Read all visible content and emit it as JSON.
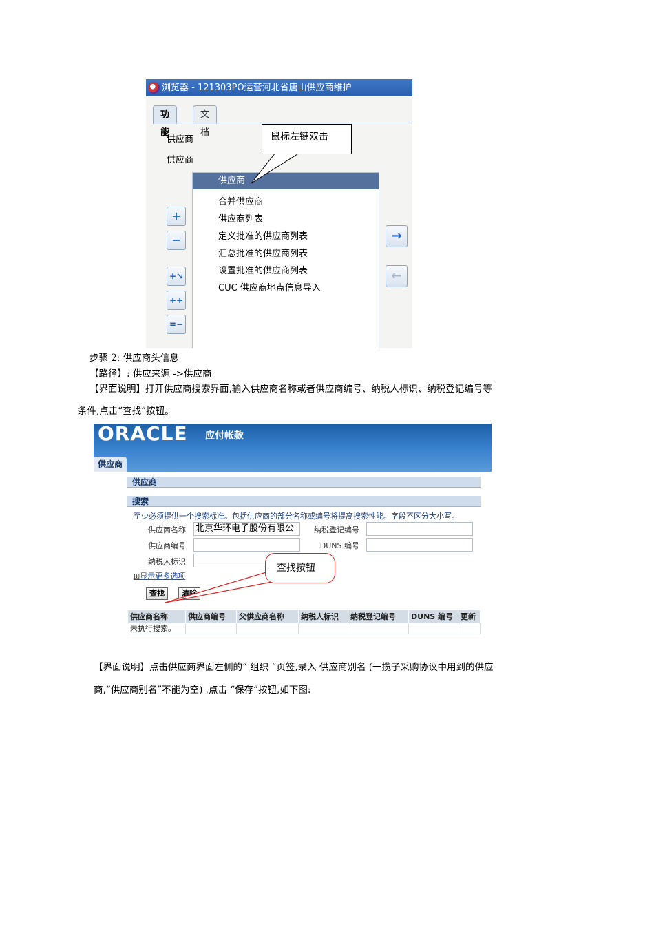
{
  "navigator": {
    "window_title": "浏览器 - 121303PO运营河北省唐山供应商维护",
    "tabs": [
      "功能",
      "文档"
    ],
    "tree_items": [
      "供应商",
      "供应商"
    ],
    "list_items": [
      "供应商",
      "合并供应商",
      "供应商列表",
      "定义批准的供应商列表",
      "汇总批准的供应商列表",
      "设置批准的供应商列表",
      "CUC 供应商地点信息导入"
    ],
    "callout": "鼠标左键双击",
    "left_buttons": [
      "+",
      "−",
      "+↘",
      "++",
      "=−"
    ],
    "right_buttons": [
      "→",
      "←"
    ]
  },
  "text": {
    "step": "步骤 2: 供应商头信息",
    "path": "【路径】: 供应来源 ->供应商",
    "desc1_line1": "【界面说明】打开供应商搜索界面,输入供应商名称或者供应商编号、纳税人标识、纳税登记编号等",
    "desc1_line2": "条件,点击“查找”按钮。",
    "desc2_line1": "【界面说明】点击供应商界面左侧的“ 组织 ”页签,录入 供应商别名 (一揽子采购协议中用到的供应",
    "desc2_line2": "商,“供应商别名”不能为空) ,点击 “保存”按钮,如下图:"
  },
  "oracle": {
    "logo": "ORACLE",
    "app_title": "应付帐款",
    "tab": "供应商",
    "page_header": "供应商",
    "search_header": "搜索",
    "hint": "至少必须提供一个搜索标准。包括供应商的部分名称或编号将提高搜索性能。字段不区分大小写。",
    "fields": {
      "supplier_name_label": "供应商名称",
      "supplier_name_value": "北京华环电子股份有限公",
      "tax_reg_label": "纳税登记编号",
      "supplier_num_label": "供应商编号",
      "duns_label": "DUNS 编号",
      "taxpayer_label": "纳税人标识"
    },
    "more_options": "显示更多选项",
    "find_button": "查找",
    "clear_button": "清除",
    "callout": "查找按钮",
    "columns": [
      "供应商名称",
      "供应商编号",
      "父供应商名称",
      "纳税人标识",
      "纳税登记编号",
      "DUNS 编号",
      "更新"
    ],
    "empty_message": "未执行搜索。"
  }
}
